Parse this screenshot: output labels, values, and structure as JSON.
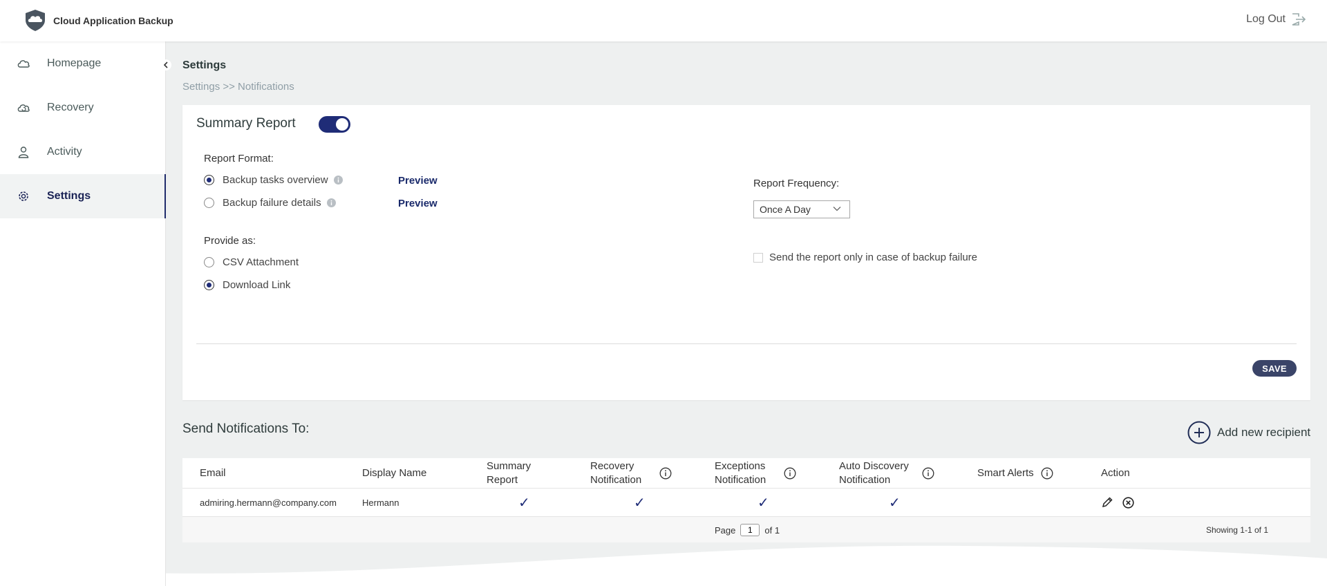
{
  "header": {
    "app_title": "Cloud Application Backup",
    "logout_label": "Log Out",
    "icons": {
      "logo": "shield-cloud-logo",
      "logout": "logout-icon"
    }
  },
  "sidebar": {
    "items": [
      {
        "label": "Homepage",
        "icon": "cloud-icon",
        "active": false
      },
      {
        "label": "Recovery",
        "icon": "cloud-refresh-icon",
        "active": false
      },
      {
        "label": "Activity",
        "icon": "user-icon",
        "active": false
      },
      {
        "label": "Settings",
        "icon": "gear-icon",
        "active": true
      }
    ]
  },
  "page": {
    "title": "Settings",
    "breadcrumb": "Settings >> Notifications"
  },
  "summary_report": {
    "title": "Summary Report",
    "enabled": true,
    "report_format_label": "Report Format:",
    "formats": [
      {
        "label": "Backup tasks overview",
        "checked": true,
        "preview": "Preview"
      },
      {
        "label": "Backup failure details",
        "checked": false,
        "preview": "Preview"
      }
    ],
    "provide_as_label": "Provide as:",
    "provide_options": [
      {
        "label": "CSV Attachment",
        "checked": false
      },
      {
        "label": "Download Link",
        "checked": true
      }
    ],
    "frequency_label": "Report Frequency:",
    "frequency_value": "Once A Day",
    "failure_only_label": "Send the report only in case of backup failure",
    "failure_only_checked": false,
    "save_label": "SAVE"
  },
  "notifications": {
    "title": "Send Notifications To:",
    "add_label": "Add new recipient",
    "columns": {
      "email": "Email",
      "display_name": "Display Name",
      "summary_report": "Summary Report",
      "recovery": "Recovery Notification",
      "exceptions": "Exceptions Notification",
      "auto_discovery": "Auto Discovery Notification",
      "smart_alerts": "Smart Alerts",
      "action": "Action"
    },
    "rows": [
      {
        "email": "admiring.hermann@company.com",
        "display_name": "Hermann",
        "summary_report": "✓",
        "recovery": "✓",
        "exceptions": "✓",
        "auto_discovery": "✓",
        "smart_alerts": ""
      }
    ],
    "pager": {
      "page_label": "Page",
      "page_value": "1",
      "of_label": "of 1"
    },
    "showing": "Showing 1-1 of 1"
  },
  "colors": {
    "accent": "#1f2c77",
    "save_bg": "#3a4468",
    "background": "#eef0f0"
  }
}
